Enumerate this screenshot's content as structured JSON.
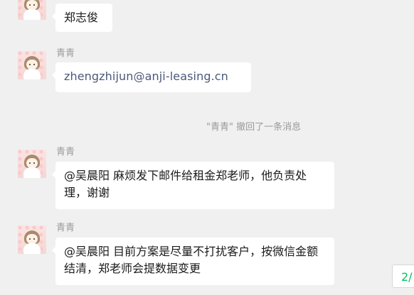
{
  "messages": [
    {
      "sender": "",
      "text": "郑志俊"
    },
    {
      "sender": "青青",
      "text": "zhengzhijun@anji-leasing.cn"
    },
    {
      "sender": "青青",
      "text": "@吴晨阳 麻烦发下邮件给租金郑老师，他负责处理，谢谢"
    },
    {
      "sender": "青青",
      "text": "@吴晨阳 目前方案是尽量不打扰客户，按微信金额结清，郑老师会提数据变更"
    }
  ],
  "system_notice": "\"青青\" 撤回了一条消息",
  "page_indicator": "2/",
  "colors": {
    "background": "#f0f0f0",
    "bubble": "#ffffff",
    "link_text": "#4a5a7a",
    "meta_text": "#9a9a9a",
    "accent_green": "#07c160"
  }
}
